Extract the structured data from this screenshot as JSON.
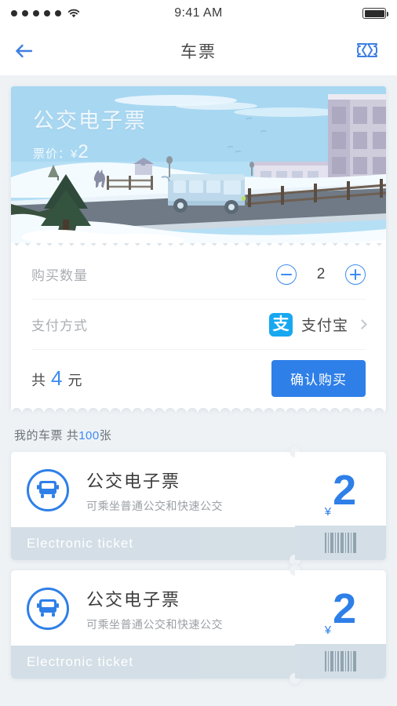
{
  "status_bar": {
    "signal_dots": 5,
    "wifi_icon": "wifi-icon",
    "time": "9:41 AM",
    "battery_icon": "battery-full-icon"
  },
  "nav": {
    "back_icon": "arrow-left-icon",
    "title": "车票",
    "action_icon": "ticket-icon"
  },
  "banner": {
    "title": "公交电子票",
    "fare_label": "票价：",
    "fare_currency": "¥",
    "fare_value": "2",
    "scene": "winter-road-bus-illustration"
  },
  "purchase": {
    "quantity": {
      "label": "购买数量",
      "minus_icon": "minus-circle-icon",
      "plus_icon": "plus-circle-icon",
      "value": "2"
    },
    "payment": {
      "label": "支付方式",
      "logo_glyph": "支",
      "logo_name": "alipay-icon",
      "method": "支付宝",
      "chevron_icon": "chevron-right-icon"
    },
    "total": {
      "prefix": "共",
      "amount": "4",
      "unit": "元"
    },
    "confirm_button": "确认购买"
  },
  "my_tickets": {
    "heading": "我的车票",
    "count_label": "共",
    "count": "100",
    "count_unit": "张",
    "items": [
      {
        "icon": "bus-icon",
        "title": "公交电子票",
        "subtitle": "可乘坐普通公交和快速公交",
        "band_text": "Electronic ticket",
        "currency": "¥",
        "price": "2",
        "barcode_icon": "barcode-icon"
      },
      {
        "icon": "bus-icon",
        "title": "公交电子票",
        "subtitle": "可乘坐普通公交和快速公交",
        "band_text": "Electronic ticket",
        "currency": "¥",
        "price": "2",
        "barcode_icon": "barcode-icon"
      }
    ]
  },
  "colors": {
    "accent_blue": "#2f7fe8",
    "link_blue": "#3d8bf2",
    "alipay_blue": "#18a8f0",
    "page_bg": "#eef2f5",
    "band_grey": "#ccd9e2"
  }
}
